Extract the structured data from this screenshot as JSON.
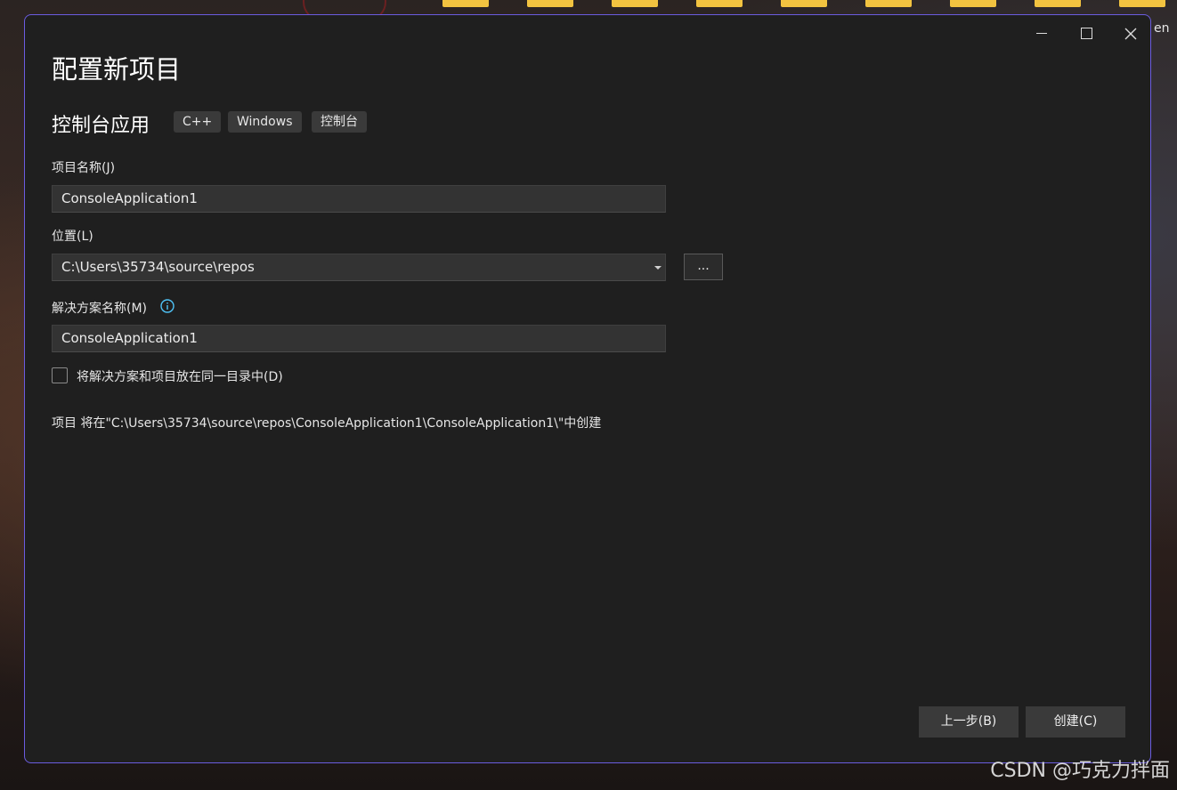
{
  "window": {
    "title": "配置新项目",
    "controls": [
      "minimize-icon",
      "maximize-icon",
      "close-icon"
    ]
  },
  "template": {
    "name": "控制台应用",
    "tags": [
      "C++",
      "Windows",
      "控制台"
    ]
  },
  "form": {
    "project_name_label": "项目名称(J)",
    "project_name_value": "ConsoleApplication1",
    "location_label": "位置(L)",
    "location_value": "C:\\Users\\35734\\source\\repos",
    "browse_label": "...",
    "solution_name_label": "解决方案名称(M)",
    "solution_name_value": "ConsoleApplication1",
    "same_dir_label": "将解决方案和项目放在同一目录中(D)",
    "same_dir_checked": false
  },
  "path_note": "项目 将在\"C:\\Users\\35734\\source\\repos\\ConsoleApplication1\\ConsoleApplication1\\\"中创建",
  "buttons": {
    "back": "上一步(B)",
    "create": "创建(C)"
  },
  "background": {
    "edge_text": "en",
    "watermark": "CSDN @巧克力拌面"
  },
  "colors": {
    "dialog_bg": "#1f1f1f",
    "dialog_border": "#6b5ce0",
    "input_bg": "#333333",
    "info_icon": "#4fc3f7"
  }
}
